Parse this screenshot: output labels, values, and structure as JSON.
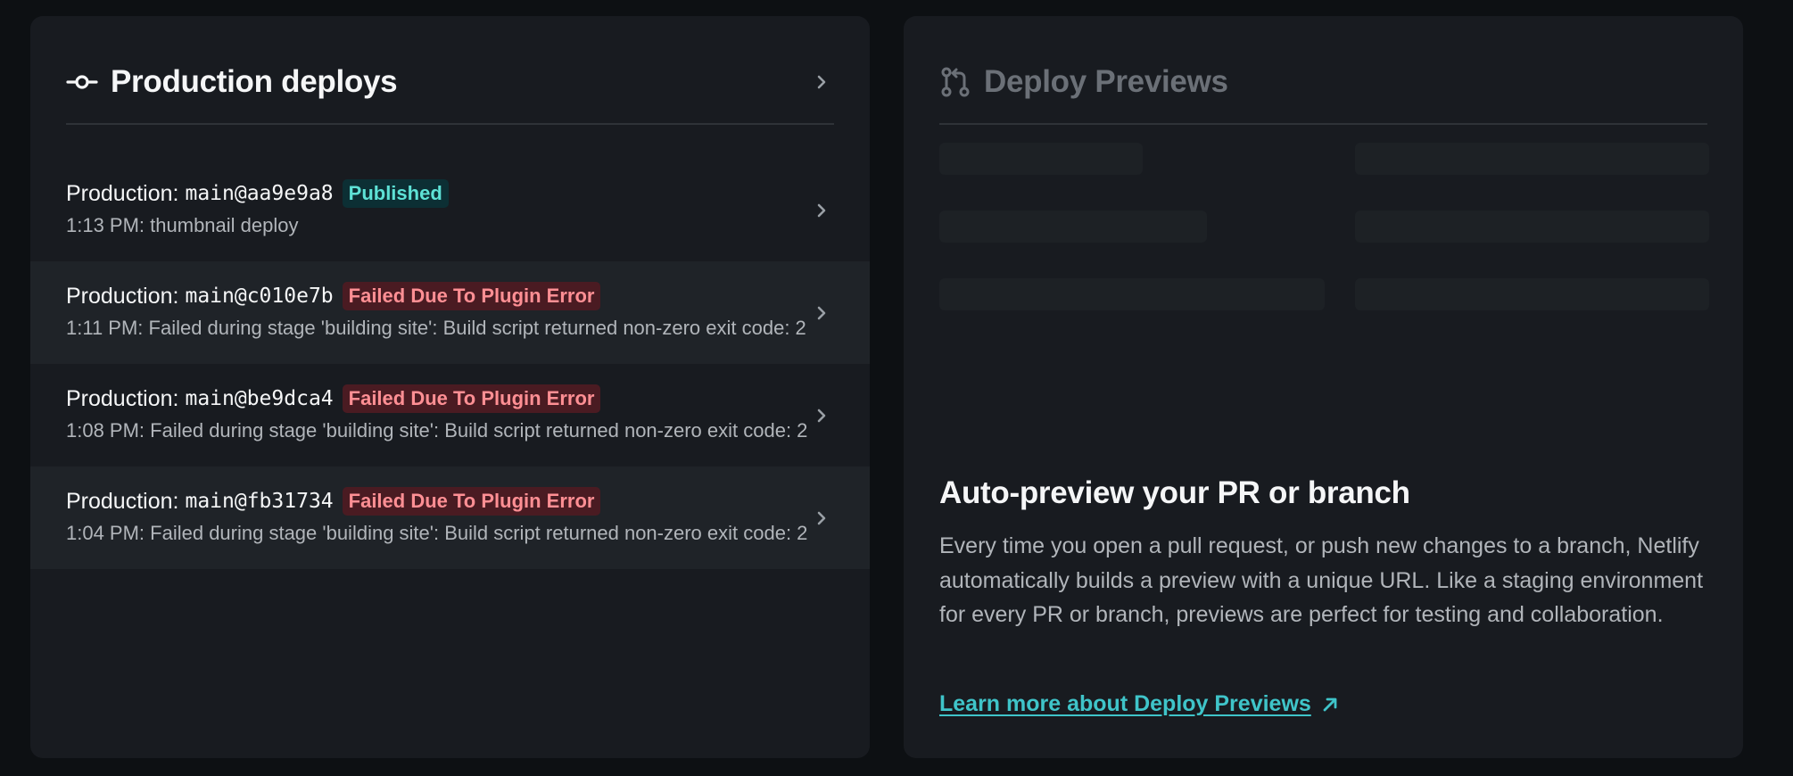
{
  "production": {
    "title": "Production deploys",
    "deploys": [
      {
        "label": "Production:",
        "ref": "main@aa9e9a8",
        "status": "Published",
        "status_kind": "success",
        "summary": "1:13 PM: thumbnail deploy"
      },
      {
        "label": "Production:",
        "ref": "main@c010e7b",
        "status": "Failed Due To Plugin Error",
        "status_kind": "error",
        "summary": "1:11 PM: Failed during stage 'building site': Build script returned non-zero exit code: 2"
      },
      {
        "label": "Production:",
        "ref": "main@be9dca4",
        "status": "Failed Due To Plugin Error",
        "status_kind": "error",
        "summary": "1:08 PM: Failed during stage 'building site': Build script returned non-zero exit code: 2"
      },
      {
        "label": "Production:",
        "ref": "main@fb31734",
        "status": "Failed Due To Plugin Error",
        "status_kind": "error",
        "summary": "1:04 PM: Failed during stage 'building site': Build script returned non-zero exit code: 2"
      }
    ]
  },
  "previews": {
    "title": "Deploy Previews",
    "promo_title": "Auto-preview your PR or branch",
    "promo_body": "Every time you open a pull request, or push new changes to a branch, Netlify automatically builds a preview with a unique URL. Like a staging environment for every PR or branch, previews are perfect for testing and collaboration.",
    "link_label": "Learn more about Deploy Previews"
  },
  "colors": {
    "background": "#0d1013",
    "card": "#181b20",
    "published_text": "#5ee2d6",
    "failed_text": "#ff8f94",
    "link": "#3fc4c9"
  },
  "icons": {
    "production": "git-commit-icon",
    "previews": "git-pull-request-icon",
    "chevron": "chevron-right-icon",
    "link": "arrow-up-right-icon"
  }
}
